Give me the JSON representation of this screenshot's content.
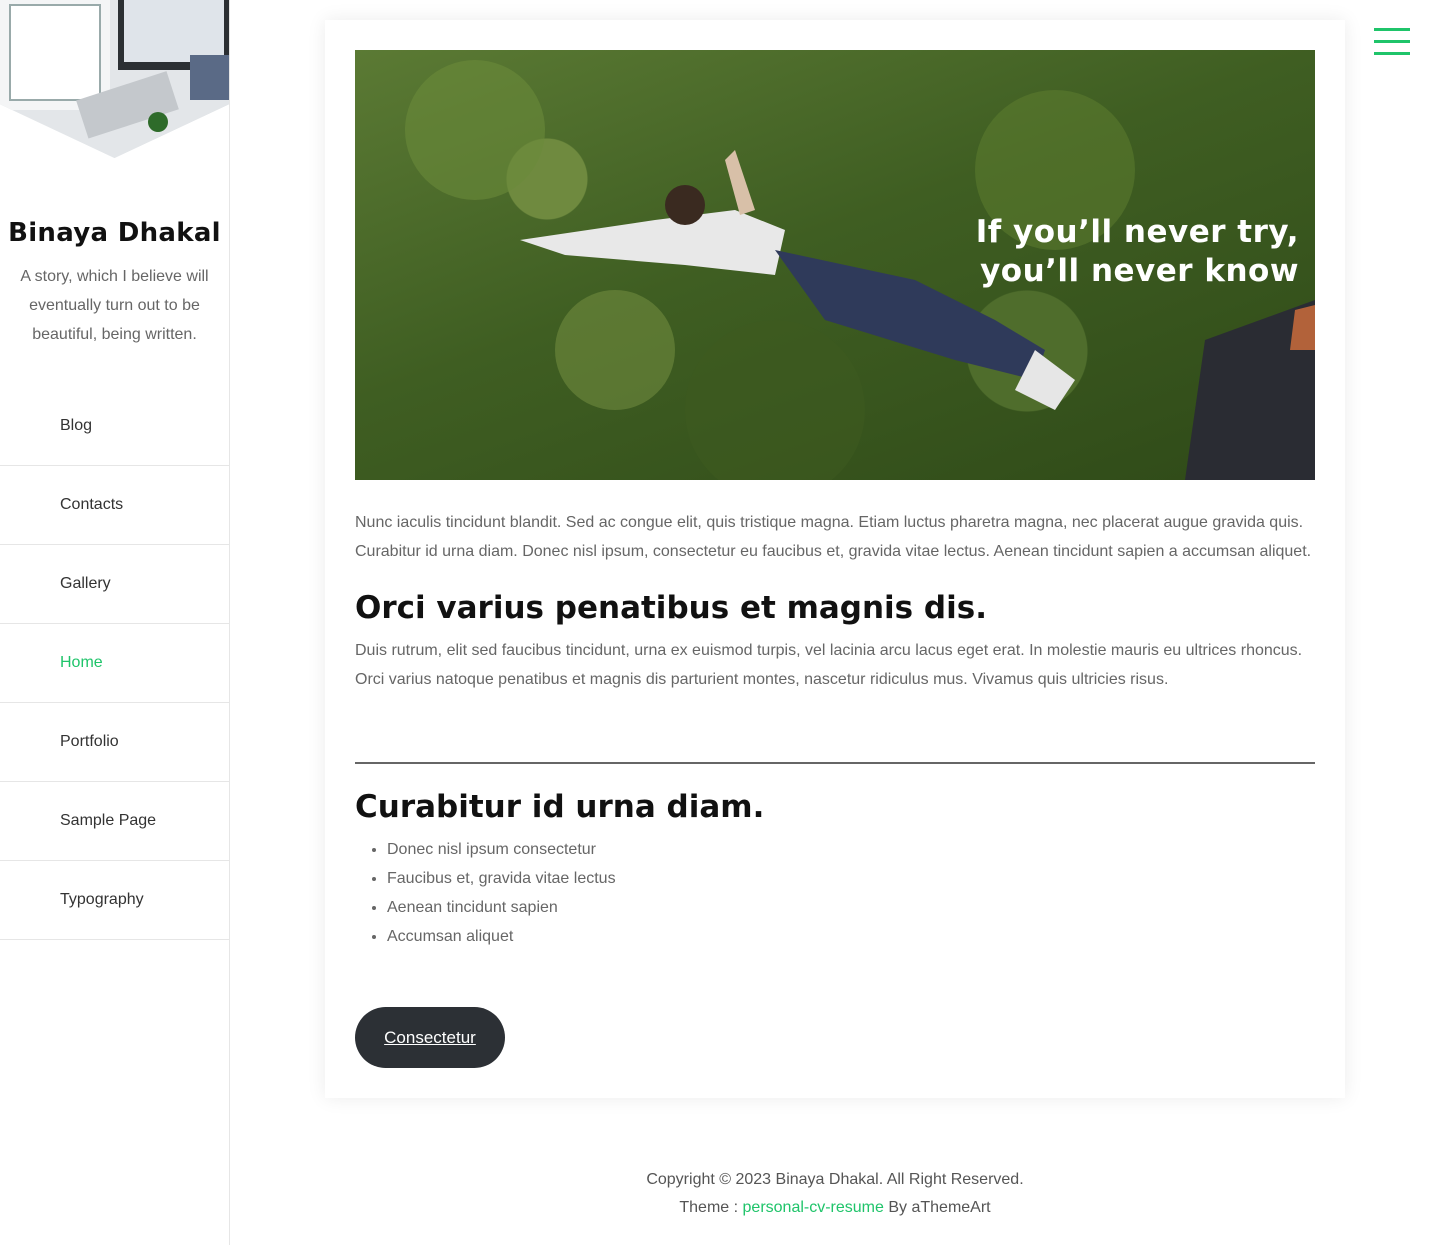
{
  "sidebar": {
    "title": "Binaya Dhakal",
    "description": "A story, which I believe will eventually turn out to be beautiful, being written.",
    "items": [
      {
        "label": "Blog"
      },
      {
        "label": "Contacts"
      },
      {
        "label": "Gallery"
      },
      {
        "label": "Home"
      },
      {
        "label": "Portfolio"
      },
      {
        "label": "Sample Page"
      },
      {
        "label": "Typography"
      }
    ],
    "active_item": "Home"
  },
  "header": {
    "menu_icon": "hamburger-icon"
  },
  "hero": {
    "line1": "If you’ll never try,",
    "line2": "you’ll never know"
  },
  "content": {
    "intro": "Nunc iaculis tincidunt blandit. Sed ac congue elit, quis tristique magna. Etiam luctus pharetra magna, nec placerat augue gravida quis. Curabitur id urna diam. Donec nisl ipsum, consectetur eu faucibus et, gravida vitae lectus. Aenean tincidunt sapien a accumsan aliquet.",
    "heading1": "Orci varius penatibus et magnis dis.",
    "para2": "Duis rutrum, elit sed faucibus tincidunt, urna ex euismod turpis, vel lacinia arcu lacus eget erat. In molestie mauris eu ultrices rhoncus. Orci varius natoque penatibus et magnis dis parturient montes, nascetur ridiculus mus. Vivamus quis ultricies risus.",
    "heading2": "Curabitur id urna diam.",
    "list": [
      "Donec nisl ipsum consectetur",
      "Faucibus et, gravida vitae lectus",
      "Aenean tincidunt sapien",
      "Accumsan aliquet"
    ],
    "button_label": "Consectetur"
  },
  "footer": {
    "copyright": "Copyright © 2023 Binaya Dhakal. All Right Reserved.",
    "theme_prefix": "Theme :",
    "theme_link": "personal-cv-resume",
    "theme_suffix": "By aThemeArt"
  },
  "colors": {
    "accent": "#1fc46a",
    "button": "#2c3035"
  }
}
